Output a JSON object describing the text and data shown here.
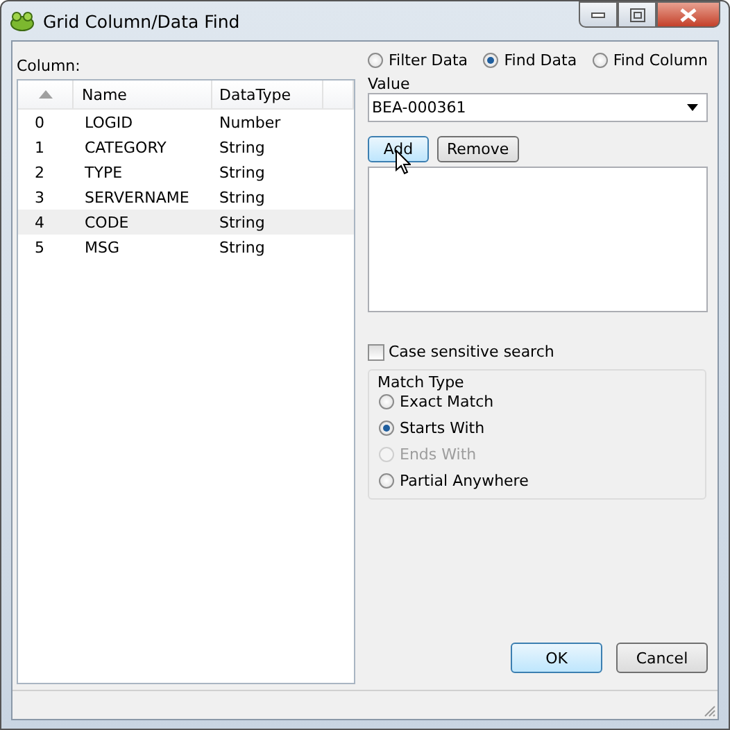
{
  "window": {
    "title": "Grid Column/Data Find"
  },
  "column_label": "Column:",
  "table": {
    "columns": [
      "Name",
      "DataType"
    ],
    "rows": [
      {
        "index": "0",
        "name": "LOGID",
        "type": "Number",
        "selected": false
      },
      {
        "index": "1",
        "name": "CATEGORY",
        "type": "String",
        "selected": false
      },
      {
        "index": "2",
        "name": "TYPE",
        "type": "String",
        "selected": false
      },
      {
        "index": "3",
        "name": "SERVERNAME",
        "type": "String",
        "selected": false
      },
      {
        "index": "4",
        "name": "CODE",
        "type": "String",
        "selected": true
      },
      {
        "index": "5",
        "name": "MSG",
        "type": "String",
        "selected": false
      }
    ]
  },
  "modes": [
    {
      "label": "Filter Data",
      "selected": false
    },
    {
      "label": "Find Data",
      "selected": true
    },
    {
      "label": "Find Column",
      "selected": false
    }
  ],
  "value_label": "Value",
  "value": "BEA-000361",
  "list_buttons": [
    {
      "label": "Add",
      "highlighted": true
    },
    {
      "label": "Remove",
      "highlighted": false
    }
  ],
  "case_sensitive": {
    "label": "Case sensitive search",
    "checked": false
  },
  "match_type": {
    "title": "Match Type",
    "options": [
      {
        "label": "Exact Match",
        "selected": false,
        "disabled": false
      },
      {
        "label": "Starts With",
        "selected": true,
        "disabled": false
      },
      {
        "label": "Ends With",
        "selected": false,
        "disabled": true
      },
      {
        "label": "Partial Anywhere",
        "selected": false,
        "disabled": false
      }
    ]
  },
  "dialog_buttons": [
    {
      "label": "OK",
      "highlighted": true
    },
    {
      "label": "Cancel",
      "highlighted": false
    }
  ]
}
